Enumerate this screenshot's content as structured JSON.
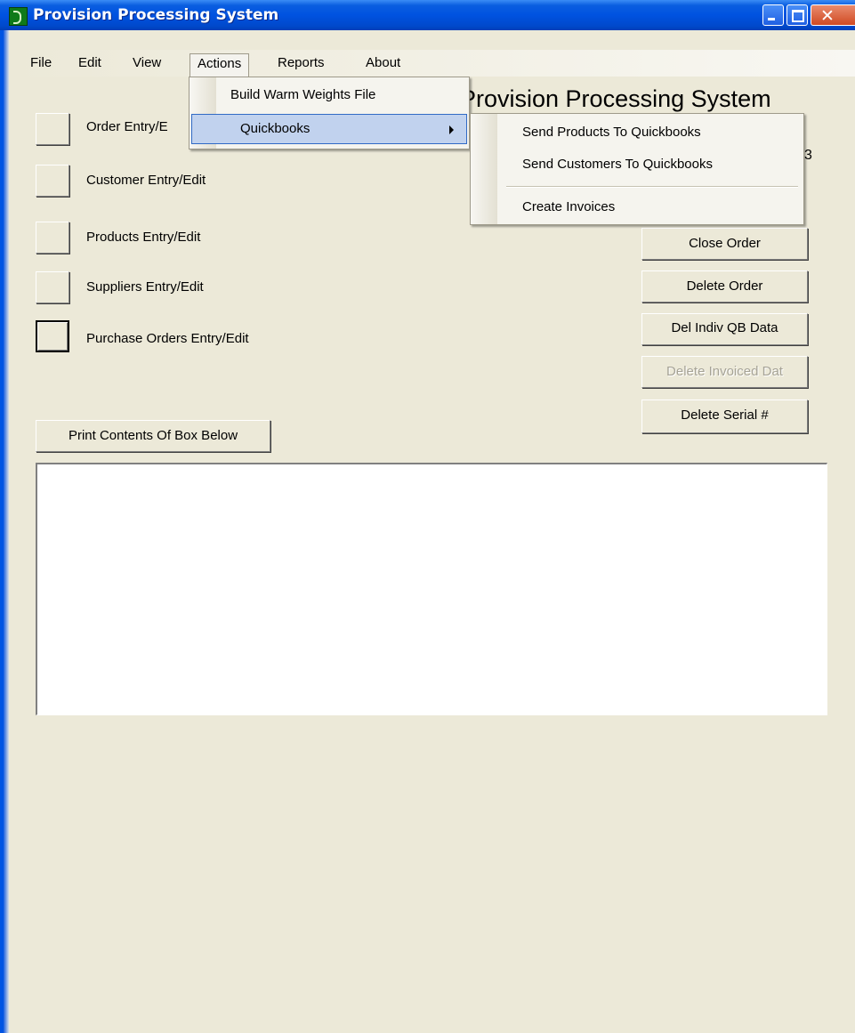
{
  "window": {
    "title": "Provision Processing System"
  },
  "menubar": {
    "items": [
      "File",
      "Edit",
      "View",
      "Actions",
      "Reports",
      "About"
    ],
    "active": "Actions"
  },
  "actions_menu": {
    "items": [
      "Build Warm Weights File",
      "Quickbooks"
    ],
    "highlighted": "Quickbooks"
  },
  "quickbooks_submenu": {
    "items": [
      "Send Products To Quickbooks",
      "Send Customers To Quickbooks",
      "Create Invoices"
    ]
  },
  "main": {
    "heading": "Provision Processing System",
    "side_number": "3",
    "entry_labels": [
      "Order Entry/E",
      "Customer  Entry/Edit",
      "Products  Entry/Edit",
      "Suppliers Entry/Edit",
      "Purchase Orders Entry/Edit"
    ],
    "right_buttons": [
      {
        "label": "Close Order",
        "enabled": true
      },
      {
        "label": "Delete Order",
        "enabled": true
      },
      {
        "label": "Del Indiv QB Data",
        "enabled": true
      },
      {
        "label": "Delete Invoiced Dat",
        "enabled": false
      },
      {
        "label": "Delete Serial #",
        "enabled": true
      }
    ],
    "print_button": "Print Contents Of Box Below"
  }
}
